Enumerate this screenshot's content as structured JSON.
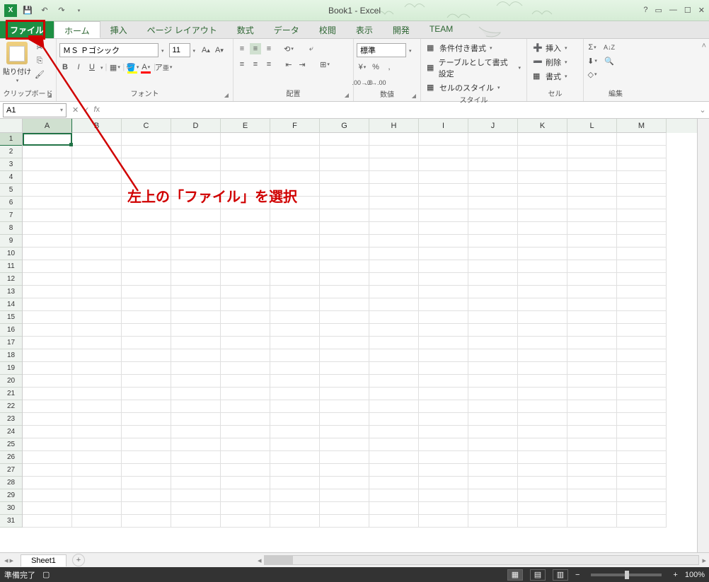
{
  "title": "Book1 - Excel",
  "tabs": {
    "file": "ファイル",
    "home": "ホーム",
    "insert": "挿入",
    "pagelayout": "ページ レイアウト",
    "formulas": "数式",
    "data": "データ",
    "review": "校閲",
    "view": "表示",
    "developer": "開発",
    "team": "TEAM"
  },
  "ribbon": {
    "clipboard": {
      "paste": "貼り付け",
      "label": "クリップボード"
    },
    "font": {
      "name": "ＭＳ Ｐゴシック",
      "size": "11",
      "label": "フォント"
    },
    "alignment": {
      "label": "配置"
    },
    "number": {
      "format": "標準",
      "label": "数値"
    },
    "styles": {
      "cond": "条件付き書式",
      "table": "テーブルとして書式設定",
      "cell": "セルのスタイル",
      "label": "スタイル"
    },
    "cells": {
      "insert": "挿入",
      "delete": "削除",
      "format": "書式",
      "label": "セル"
    },
    "editing": {
      "label": "編集"
    }
  },
  "namebox": "A1",
  "columns": [
    "A",
    "B",
    "C",
    "D",
    "E",
    "F",
    "G",
    "H",
    "I",
    "J",
    "K",
    "L",
    "M"
  ],
  "rows_count": 31,
  "sheet": {
    "name": "Sheet1"
  },
  "status": {
    "ready": "準備完了",
    "zoom": "100%"
  },
  "annotation": "左上の「ファイル」を選択"
}
